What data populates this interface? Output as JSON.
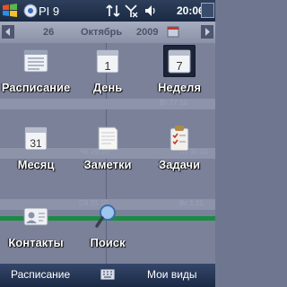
{
  "statusbar": {
    "app_title": "PI 9",
    "time": "20:06"
  },
  "datebar": {
    "day": "26",
    "month": "Октябрь",
    "year": "2009"
  },
  "week_labels": {
    "r2_right": "Вт 27.10",
    "r3_left": "Чт 29.10",
    "r3_right": "Пт 30.10",
    "r4_left": "Сб 31.10",
    "r4_right": "Вс 1.11"
  },
  "tiles": {
    "schedule": {
      "label": "Расписание"
    },
    "day": {
      "label": "День",
      "icon_number": "1"
    },
    "week": {
      "label": "Неделя",
      "icon_number": "7"
    },
    "month": {
      "label": "Месяц",
      "icon_number": "31"
    },
    "notes": {
      "label": "Заметки"
    },
    "tasks": {
      "label": "Задачи"
    },
    "contacts": {
      "label": "Контакты"
    },
    "search": {
      "label": "Поиск"
    }
  },
  "bottombar": {
    "left": "Расписание",
    "right": "Мои виды"
  }
}
